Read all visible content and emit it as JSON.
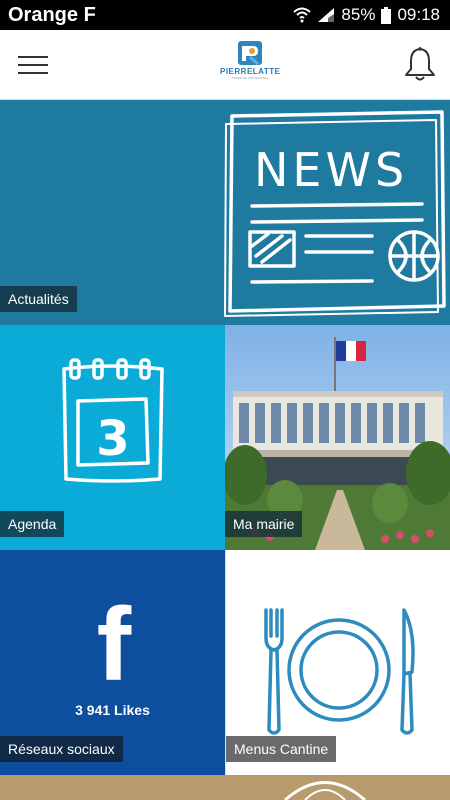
{
  "status_bar": {
    "carrier": "Orange F",
    "battery": "85%",
    "time": "09:18"
  },
  "header": {
    "logo_text": "PIERRELATTE",
    "logo_tagline": "TERRE DE CONTRASTES",
    "menu_icon": "hamburger-icon",
    "bell_icon": "bell-icon"
  },
  "tiles": {
    "news": {
      "label": "Actualités",
      "icon": "newspaper-icon",
      "art_text": "NEWS"
    },
    "agenda": {
      "label": "Agenda",
      "icon": "calendar-icon",
      "calendar_number": "3"
    },
    "mairie": {
      "label": "Ma mairie",
      "icon": "town-hall-photo"
    },
    "social": {
      "label": "Réseaux sociaux",
      "icon": "facebook-icon",
      "facebook_letter": "f",
      "likes": "3 941 Likes"
    },
    "cantine": {
      "label": "Menus Cantine",
      "icon": "plate-cutlery-icon"
    }
  },
  "colors": {
    "news_bg": "#1f7aa0",
    "agenda_bg": "#0aabd6",
    "social_bg": "#0e4e9e",
    "cantine_icon": "#2d8cbf",
    "bottom_strip": "#b79b6c"
  }
}
